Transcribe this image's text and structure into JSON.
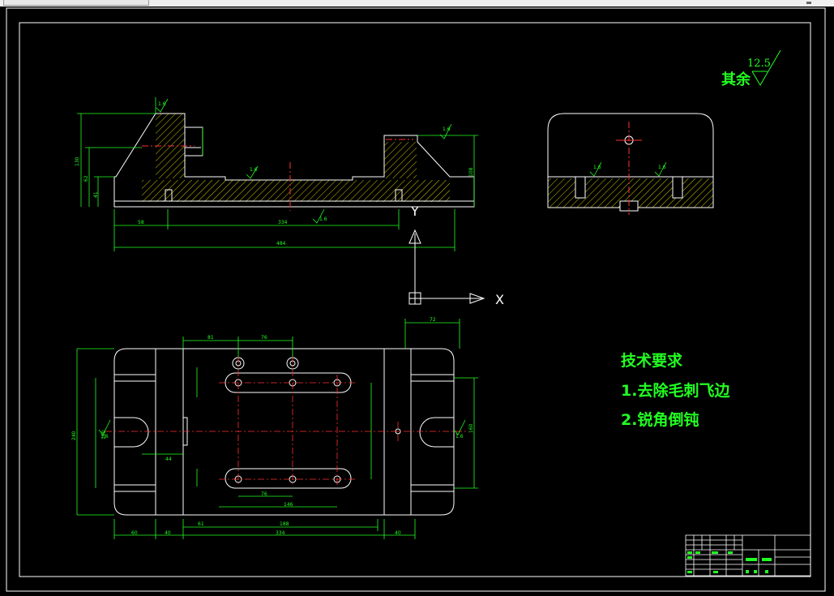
{
  "colors": {
    "background": "#000000",
    "outline": "#ffffff",
    "dimension": "#22ff22",
    "centerline": "#ff3030",
    "hatch": "#ffff00",
    "titlebar": "#f0f0f0"
  },
  "roughness_note": {
    "prefix": "其余",
    "value": "12.5"
  },
  "tech_requirements": {
    "heading": "技术要求",
    "items": [
      "1.去除毛刺飞边",
      "2.锐角倒钝"
    ]
  },
  "ucs_axes": {
    "x": "X",
    "y": "Y"
  },
  "front_view_dims": {
    "overall_length": "484",
    "inner_length": "334",
    "left_offset": "58",
    "overall_height": "130",
    "step_height": "62",
    "base_height": "41",
    "right_height": "108",
    "roughness": [
      "1.6",
      "1.6",
      "1.6",
      "1.6"
    ]
  },
  "top_view_dims": {
    "overall_width": "240",
    "left_gap": "61",
    "bottom_total": "334",
    "inner_span": "188",
    "hole_spacing_a": "76",
    "hole_spacing_b": "146",
    "top_left": "81",
    "top_mid": "76",
    "right_width": "72",
    "left_edge": "60",
    "left_edge_2": "40",
    "right_edge": "40",
    "right_height": "160",
    "left_height": "160",
    "mid_left": "44",
    "slot_roughness": [
      "1.6",
      "1.6"
    ]
  },
  "side_view_dims": {
    "roughness": [
      "1.6",
      "1.6"
    ]
  }
}
